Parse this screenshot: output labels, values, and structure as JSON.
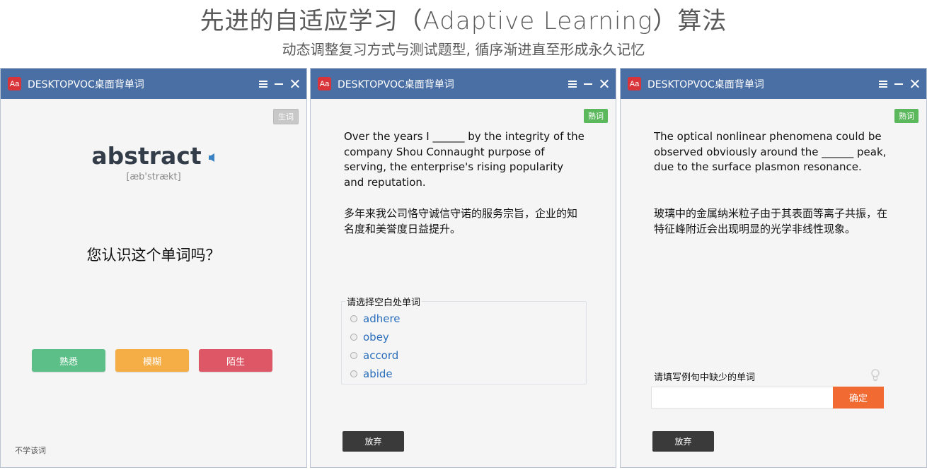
{
  "header": {
    "title": "先进的自适应学习（Adaptive Learning）算法",
    "subtitle": "动态调整复习方式与测试题型, 循序渐进直至形成永久记忆"
  },
  "app": {
    "logo": "Aa",
    "title": "DESKTOPVOC桌面背单词",
    "icons": [
      "menu-icon",
      "minimize-icon",
      "close-icon"
    ]
  },
  "window1": {
    "badge": "生词",
    "word": "abstract",
    "phonetic": "[æb'strækt]",
    "question": "您认识这个单词吗？",
    "buttons": {
      "familiar": "熟悉",
      "vague": "模糊",
      "unfamiliar": "陌生"
    },
    "skip_link": "不学该词",
    "colors": {
      "familiar": "#5cbf87",
      "vague": "#f5ad45",
      "unfamiliar": "#de5766"
    }
  },
  "window2": {
    "badge": "熟词",
    "sentence": "Over the years I ______ by the integrity of the company Shou Connaught purpose of serving, the enterprise's rising popularity and reputation.",
    "translation": "多年来我公司恪守诚信守诺的服务宗旨，企业的知名度和美誉度日益提升。",
    "legend": "请选择空白处单词",
    "options": [
      "adhere",
      "obey",
      "accord",
      "abide"
    ],
    "give_up": "放弃"
  },
  "window3": {
    "badge": "熟词",
    "sentence": "The optical nonlinear phenomena could be observed obviously around the ______ peak, due to the surface plasmon resonance.",
    "translation": "玻璃中的金属纳米粒子由于其表面等离子共振，在特征峰附近会出现明显的光学非线性现象。",
    "fill_label": "请填写例句中缺少的单词",
    "input_value": "",
    "confirm": "确定",
    "give_up": "放弃"
  }
}
